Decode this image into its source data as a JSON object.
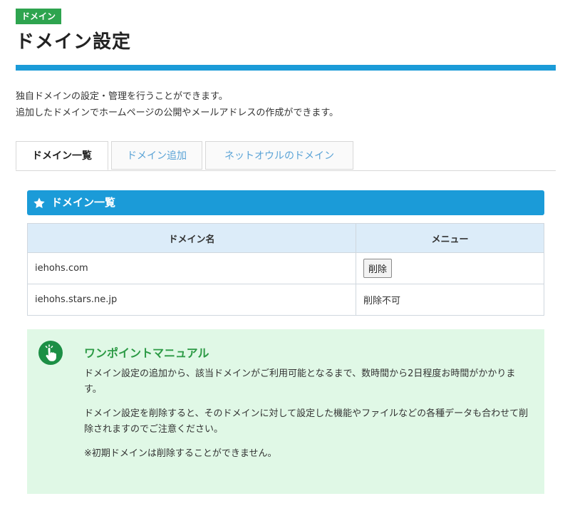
{
  "header": {
    "badge": "ドメイン",
    "title": "ドメイン設定"
  },
  "description": {
    "line1": "独自ドメインの設定・管理を行うことができます。",
    "line2": "追加したドメインでホームページの公開やメールアドレスの作成ができます。"
  },
  "tabs": [
    {
      "label": "ドメイン一覧",
      "active": true
    },
    {
      "label": "ドメイン追加",
      "active": false
    },
    {
      "label": "ネットオウルのドメイン",
      "active": false
    }
  ],
  "section": {
    "title": "ドメイン一覧",
    "icon": "star-icon"
  },
  "table": {
    "headers": [
      "ドメイン名",
      "メニュー"
    ],
    "rows": [
      {
        "domain": "iehohs.com",
        "menu": "削除",
        "menu_type": "button"
      },
      {
        "domain": "iehohs.stars.ne.jp",
        "menu": "削除不可",
        "menu_type": "text"
      }
    ]
  },
  "tips": {
    "icon": "hand-pointer-icon",
    "title": "ワンポイントマニュアル",
    "p1": "ドメイン設定の追加から、該当ドメインがご利用可能となるまで、数時間から2日程度お時間がかかります。",
    "p2": "ドメイン設定を削除すると、そのドメインに対して設定した機能やファイルなどの各種データも合わせて削除されますのでご注意ください。",
    "p3": "※初期ドメインは削除することができません。"
  },
  "colors": {
    "accent_blue": "#1b9bd8",
    "badge_green": "#2ea44f",
    "tips_bg": "#e0f8e6",
    "tips_title": "#2c9a45"
  }
}
